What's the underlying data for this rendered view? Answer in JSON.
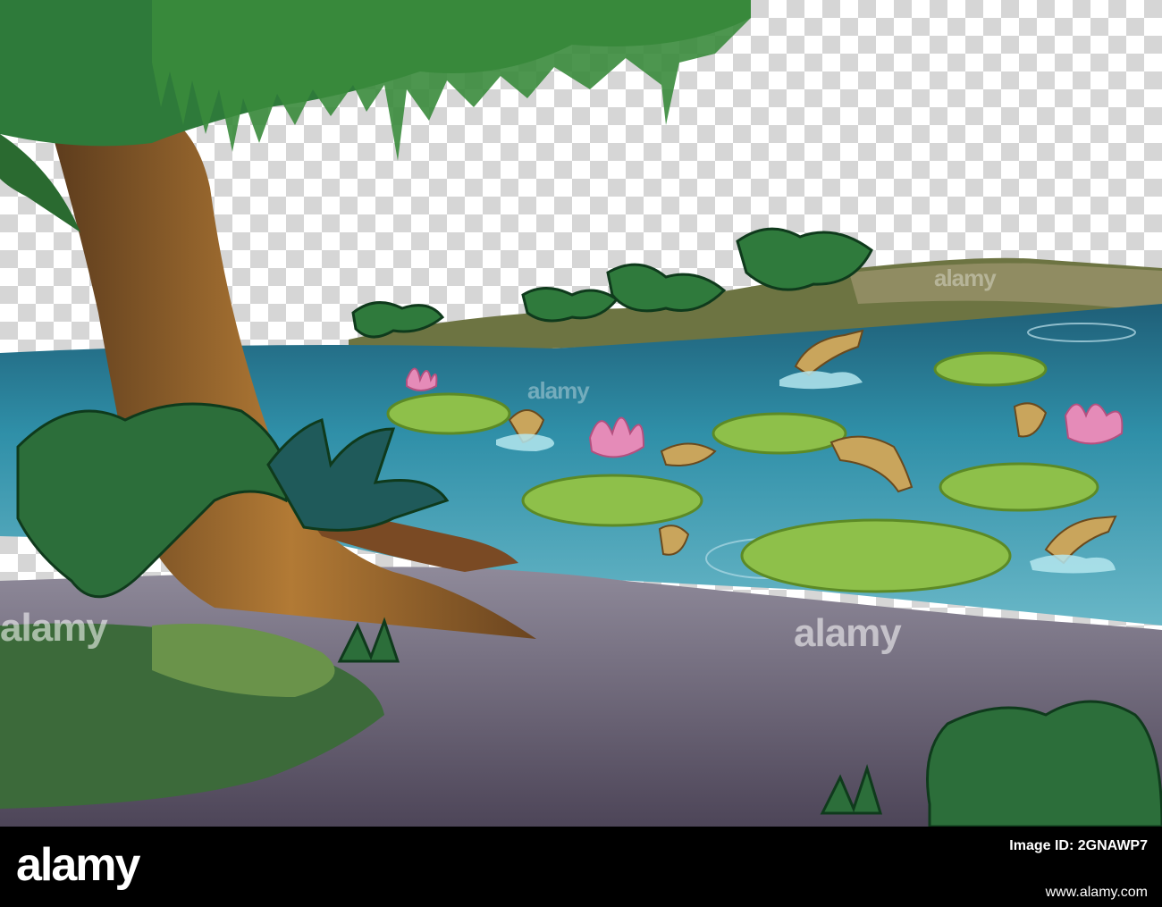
{
  "watermarks": [
    "alamy",
    "alamy",
    "alamy",
    "alamy"
  ],
  "footer": {
    "logo": "alamy",
    "image_id_label": "Image ID: 2GNAWP7",
    "site": "www.alamy.com"
  },
  "colors": {
    "water": "#2f8fa8",
    "lily_pad": "#8ec04a",
    "lotus": "#e58bb8",
    "footer_bg": "#000000"
  }
}
